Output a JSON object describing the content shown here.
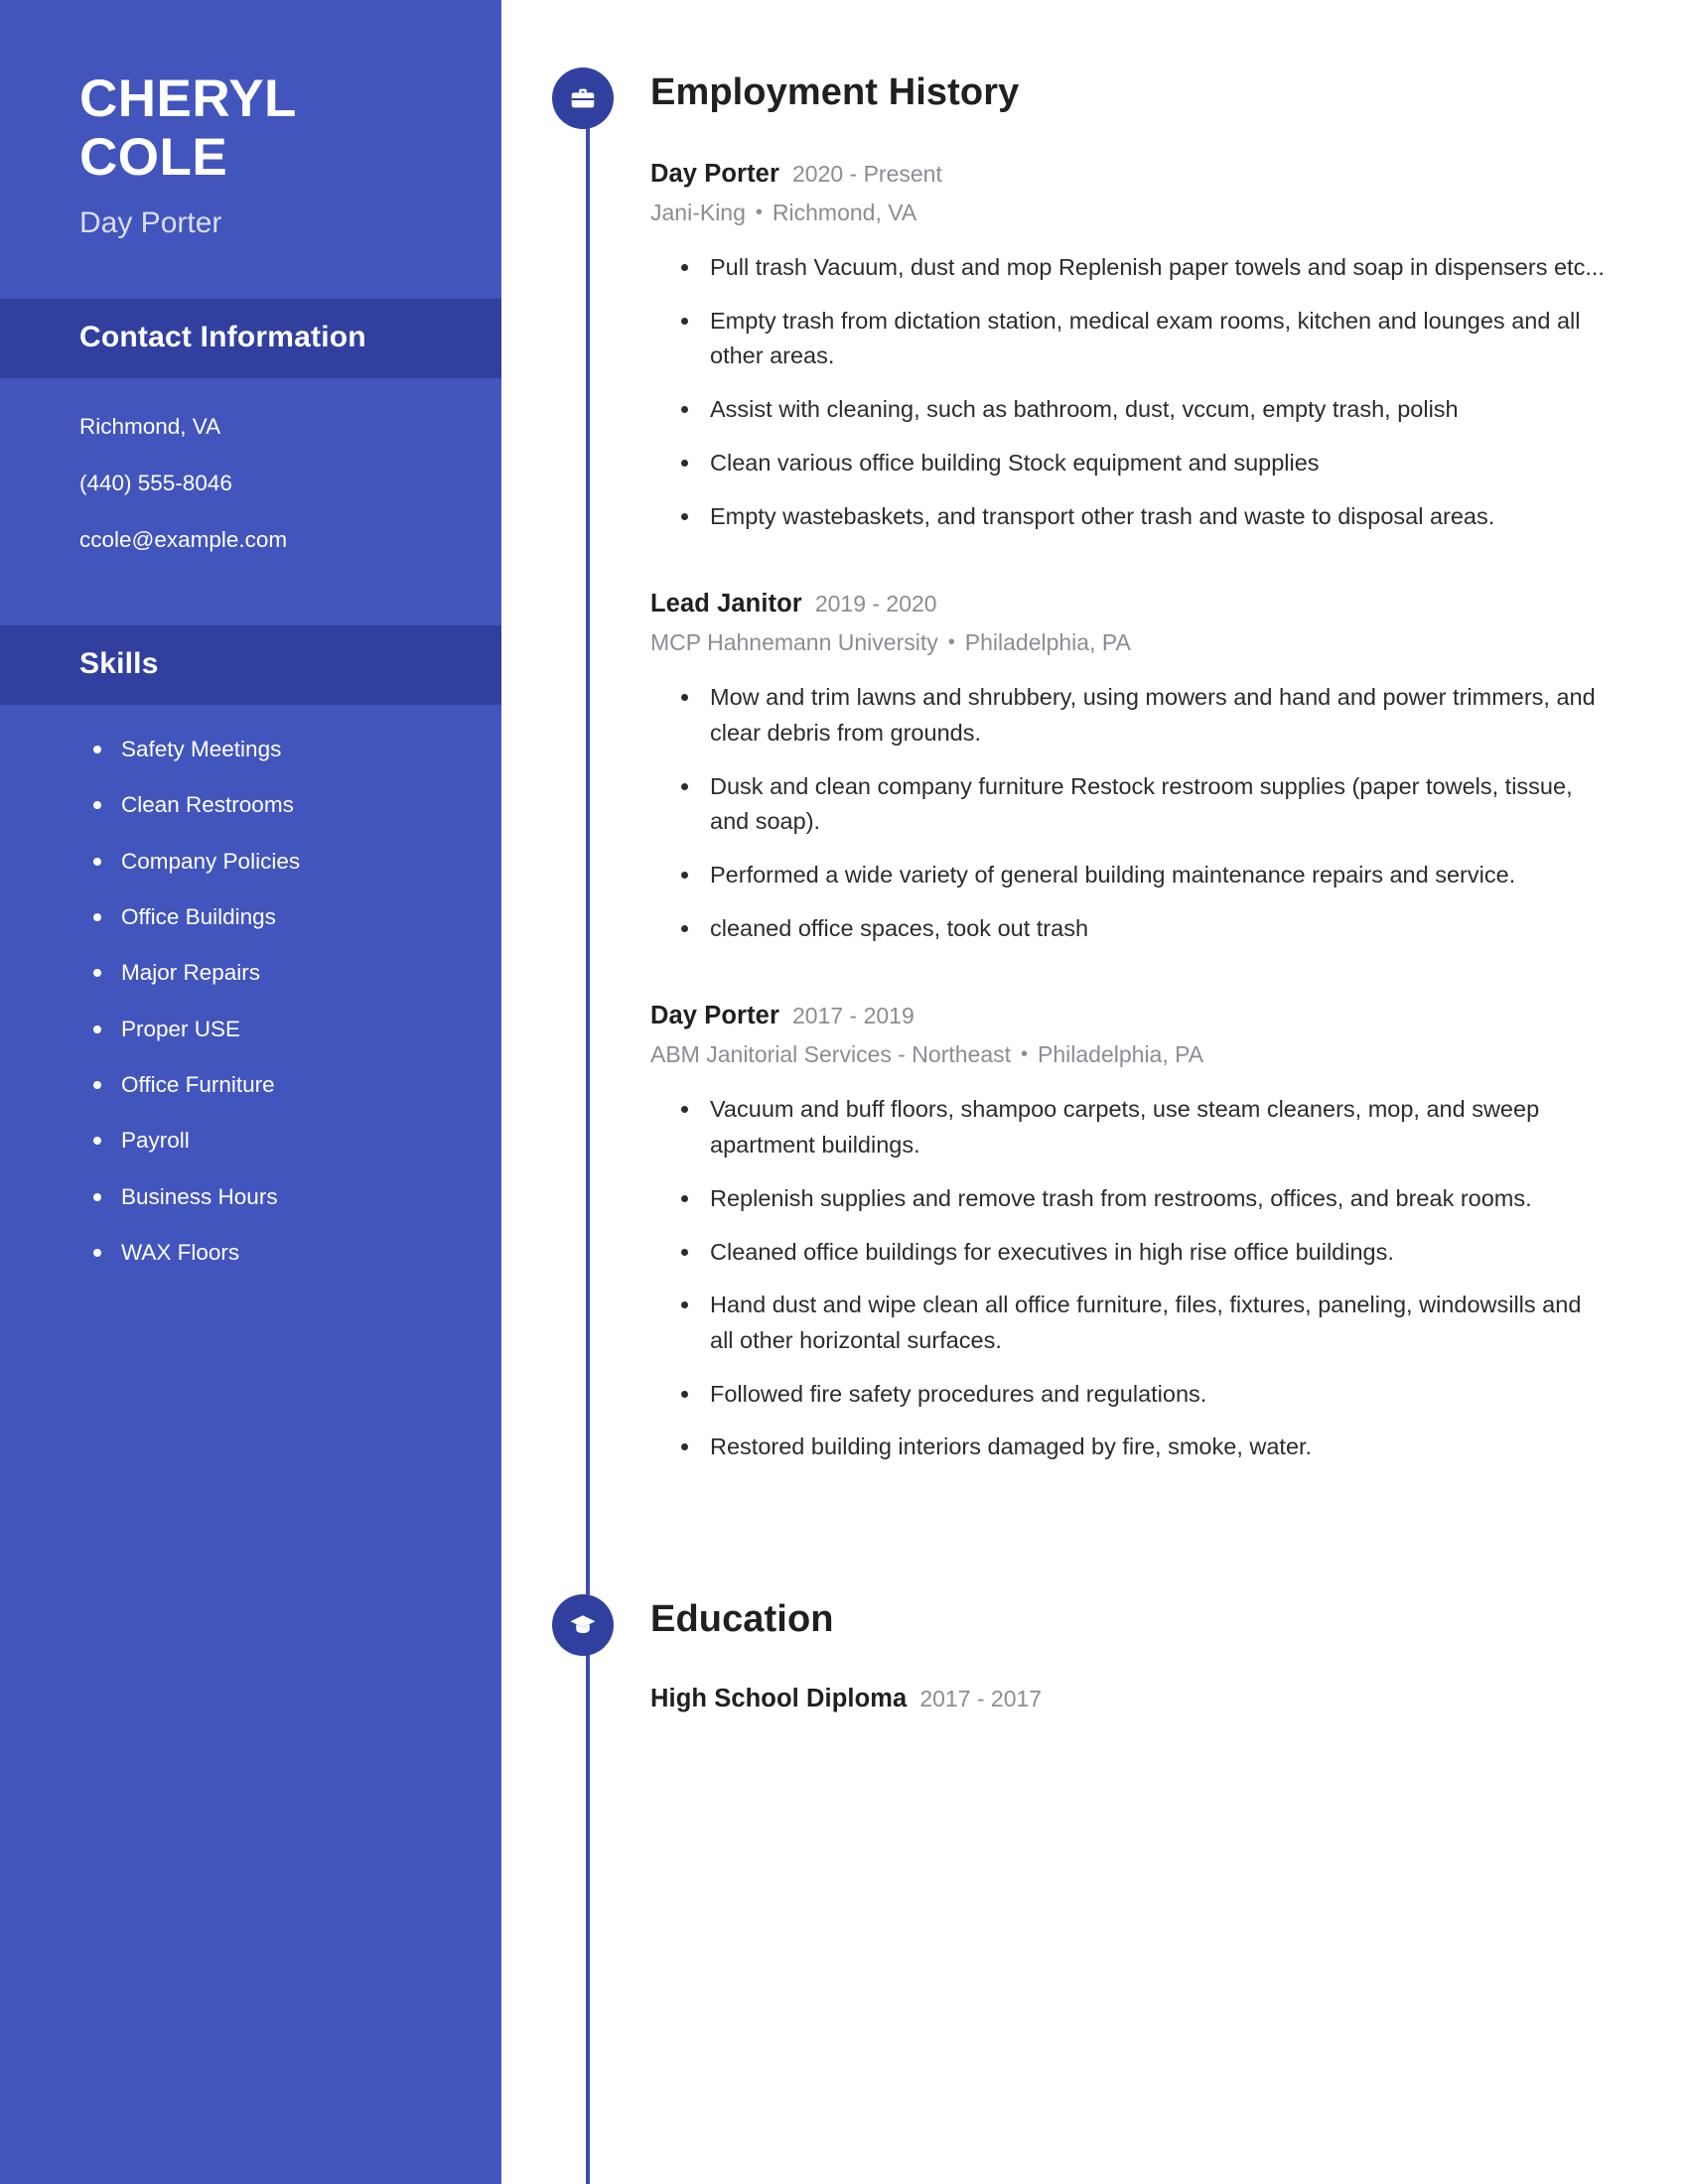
{
  "theme": {
    "sidebar_bg": "#4255bd",
    "sidebar_band_bg": "#31409f",
    "marker_bg": "#31409f",
    "rail_color": "#3b4cb8",
    "heading_color": "#1f2023",
    "muted_color": "#8b8d93",
    "body_color": "#2b2c30"
  },
  "sidebar": {
    "first_name": "CHERYL",
    "last_name": "COLE",
    "job_title": "Day Porter",
    "contact_section_title": "Contact Information",
    "contact": [
      "Richmond, VA",
      "(440) 555-8046",
      "ccole@example.com"
    ],
    "skills_section_title": "Skills",
    "skills": [
      "Safety Meetings",
      "Clean Restrooms",
      "Company Policies",
      "Office Buildings",
      "Major Repairs",
      "Proper USE",
      "Office Furniture",
      "Payroll",
      "Business Hours",
      "WAX Floors"
    ]
  },
  "employment": {
    "section_title": "Employment History",
    "icon": "briefcase-icon",
    "entries": [
      {
        "role": "Day Porter",
        "dates": "2020 - Present",
        "company": "Jani-King",
        "location": "Richmond, VA",
        "duties": [
          "Pull trash Vacuum, dust and mop Replenish paper towels and soap in dispensers etc...",
          "Empty trash from dictation station, medical exam rooms, kitchen and lounges and all other areas.",
          "Assist with cleaning, such as bathroom, dust, vccum, empty trash, polish",
          "Clean various office building Stock equipment and supplies",
          "Empty wastebaskets, and transport other trash and waste to disposal areas."
        ]
      },
      {
        "role": "Lead Janitor",
        "dates": "2019 - 2020",
        "company": "MCP Hahnemann University",
        "location": "Philadelphia, PA",
        "duties": [
          "Mow and trim lawns and shrubbery, using mowers and hand and power trimmers, and clear debris from grounds.",
          "Dusk and clean company furniture Restock restroom supplies (paper towels, tissue, and soap).",
          "Performed a wide variety of general building maintenance repairs and service.",
          "cleaned office spaces, took out trash"
        ]
      },
      {
        "role": "Day Porter",
        "dates": "2017 - 2019",
        "company": "ABM Janitorial Services - Northeast",
        "location": "Philadelphia, PA",
        "duties": [
          "Vacuum and buff floors, shampoo carpets, use steam cleaners, mop, and sweep apartment buildings.",
          "Replenish supplies and remove trash from restrooms, offices, and break rooms.",
          "Cleaned office buildings for executives in high rise office buildings.",
          "Hand dust and wipe clean all office furniture, files, fixtures, paneling, windowsills and all other horizontal surfaces.",
          "Followed fire safety procedures and regulations.",
          "Restored building interiors damaged by fire, smoke, water."
        ]
      }
    ]
  },
  "education": {
    "section_title": "Education",
    "icon": "graduation-cap-icon",
    "entries": [
      {
        "degree": "High School Diploma",
        "dates": "2017 - 2017"
      }
    ]
  }
}
